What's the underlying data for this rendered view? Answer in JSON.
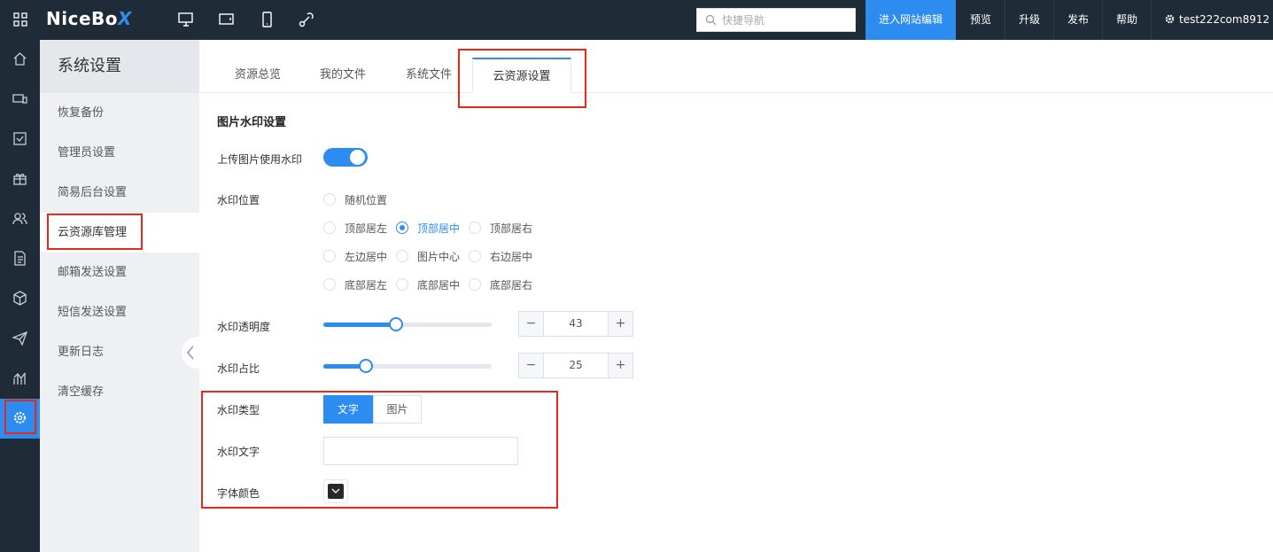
{
  "topbar": {
    "logo_text": "NiceBo",
    "logo_accent": "X",
    "search_placeholder": "快捷导航",
    "nav": [
      "进入网站编辑",
      "预览",
      "升级",
      "发布",
      "帮助"
    ],
    "user": "test222com8912"
  },
  "sidebar": {
    "title": "系统设置",
    "items": [
      "恢复备份",
      "管理员设置",
      "简易后台设置",
      "云资源库管理",
      "邮箱发送设置",
      "短信发送设置",
      "更新日志",
      "清空缓存"
    ]
  },
  "tabs": [
    "资源总览",
    "我的文件",
    "系统文件",
    "云资源设置"
  ],
  "form": {
    "section_title": "图片水印设置",
    "upload_watermark_label": "上传图片使用水印",
    "upload_watermark_on": true,
    "position_label": "水印位置",
    "positions": {
      "random": "随机位置",
      "top_left": "顶部居左",
      "top_center": "顶部居中",
      "top_right": "顶部居右",
      "mid_left": "左边居中",
      "center": "图片中心",
      "mid_right": "右边居中",
      "bottom_left": "底部居左",
      "bottom_center": "底部居中",
      "bottom_right": "底部居右"
    },
    "selected_position": "顶部居中",
    "opacity_label": "水印透明度",
    "opacity_value": "43",
    "ratio_label": "水印占比",
    "ratio_value": "25",
    "minus": "−",
    "plus": "+",
    "type_label": "水印类型",
    "type_text": "文字",
    "type_image": "图片",
    "text_label": "水印文字",
    "text_value": "",
    "color_label": "字体颜色",
    "font_color": "#282828"
  },
  "colors": {
    "accent": "#2d8cf0",
    "topbar": "#202b38",
    "highlight": "#e8271b"
  }
}
